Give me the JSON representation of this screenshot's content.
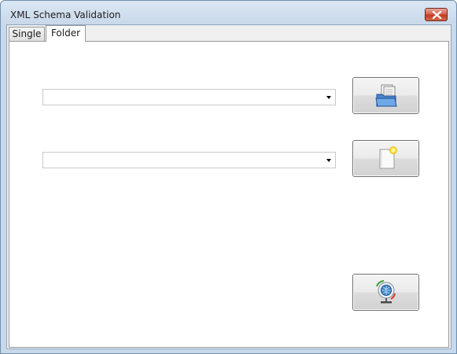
{
  "window": {
    "title": "XML Schema Validation"
  },
  "tabs": [
    {
      "label": "Single",
      "selected": false
    },
    {
      "label": "Folder",
      "selected": true
    }
  ],
  "folder_panel": {
    "source_combo": {
      "value": ""
    },
    "schema_combo": {
      "value": ""
    },
    "browse_folder_button": {
      "icon": "open-folder-icon"
    },
    "new_file_button": {
      "icon": "new-document-icon"
    },
    "validate_button": {
      "icon": "network-globe-icon"
    }
  },
  "colors": {
    "close_button": "#c23b23",
    "folder_icon": "#3b78c4",
    "title_bar": "#c8d9ea"
  }
}
